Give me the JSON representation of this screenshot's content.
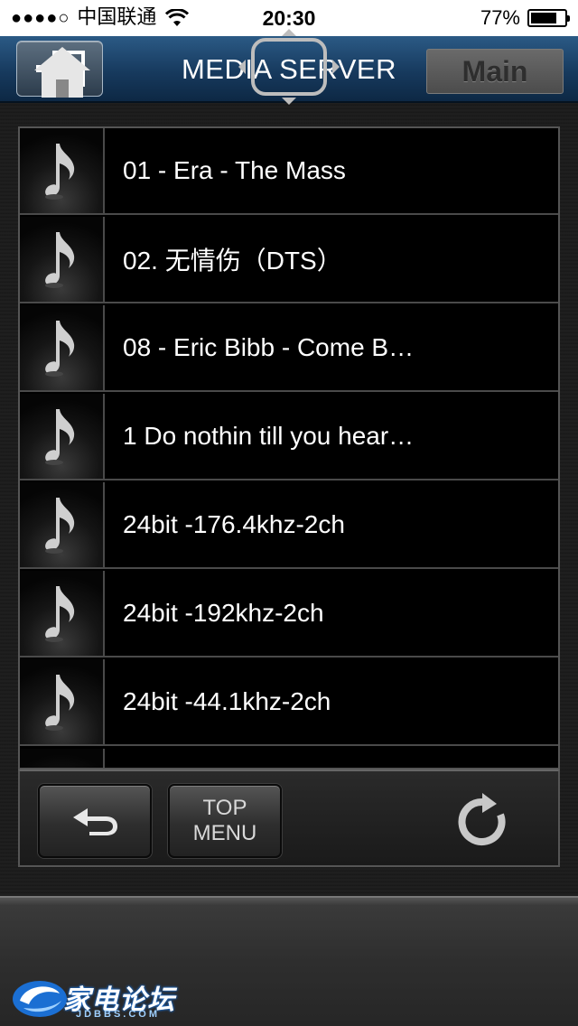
{
  "status_bar": {
    "signal": "●●●●○",
    "carrier": "中国联通",
    "time": "20:30",
    "battery": "77%",
    "battery_level": 0.77
  },
  "header": {
    "title": "MEDIA SERVER",
    "exit_icon": "exit-icon"
  },
  "list": {
    "items": [
      {
        "label": "01 - Era - The Mass",
        "icon": "music-note-icon"
      },
      {
        "label": "02. 无情伤（DTS）",
        "icon": "music-note-icon"
      },
      {
        "label": "08 - Eric Bibb - Come B…",
        "icon": "music-note-icon"
      },
      {
        "label": "1 Do nothin till you hear…",
        "icon": "music-note-icon"
      },
      {
        "label": "24bit -176.4khz-2ch",
        "icon": "music-note-icon"
      },
      {
        "label": "24bit -192khz-2ch",
        "icon": "music-note-icon"
      },
      {
        "label": "24bit -44.1khz-2ch",
        "icon": "music-note-icon"
      }
    ]
  },
  "toolbar": {
    "back_icon": "return-arrow-icon",
    "top_menu_line1": "TOP",
    "top_menu_line2": "MENU",
    "refresh_icon": "refresh-icon"
  },
  "bottom_bar": {
    "home_icon": "home-icon",
    "nav_icon": "navigation-pad-icon",
    "main_label": "Main"
  },
  "watermark": {
    "text": "家电论坛",
    "sub": "JDBBS.COM"
  },
  "colors": {
    "header_blue": "#173a5e",
    "list_bg": "#000000",
    "toolbar_bg": "#2a2a2a",
    "watermark_blue": "#1b6fd3"
  }
}
